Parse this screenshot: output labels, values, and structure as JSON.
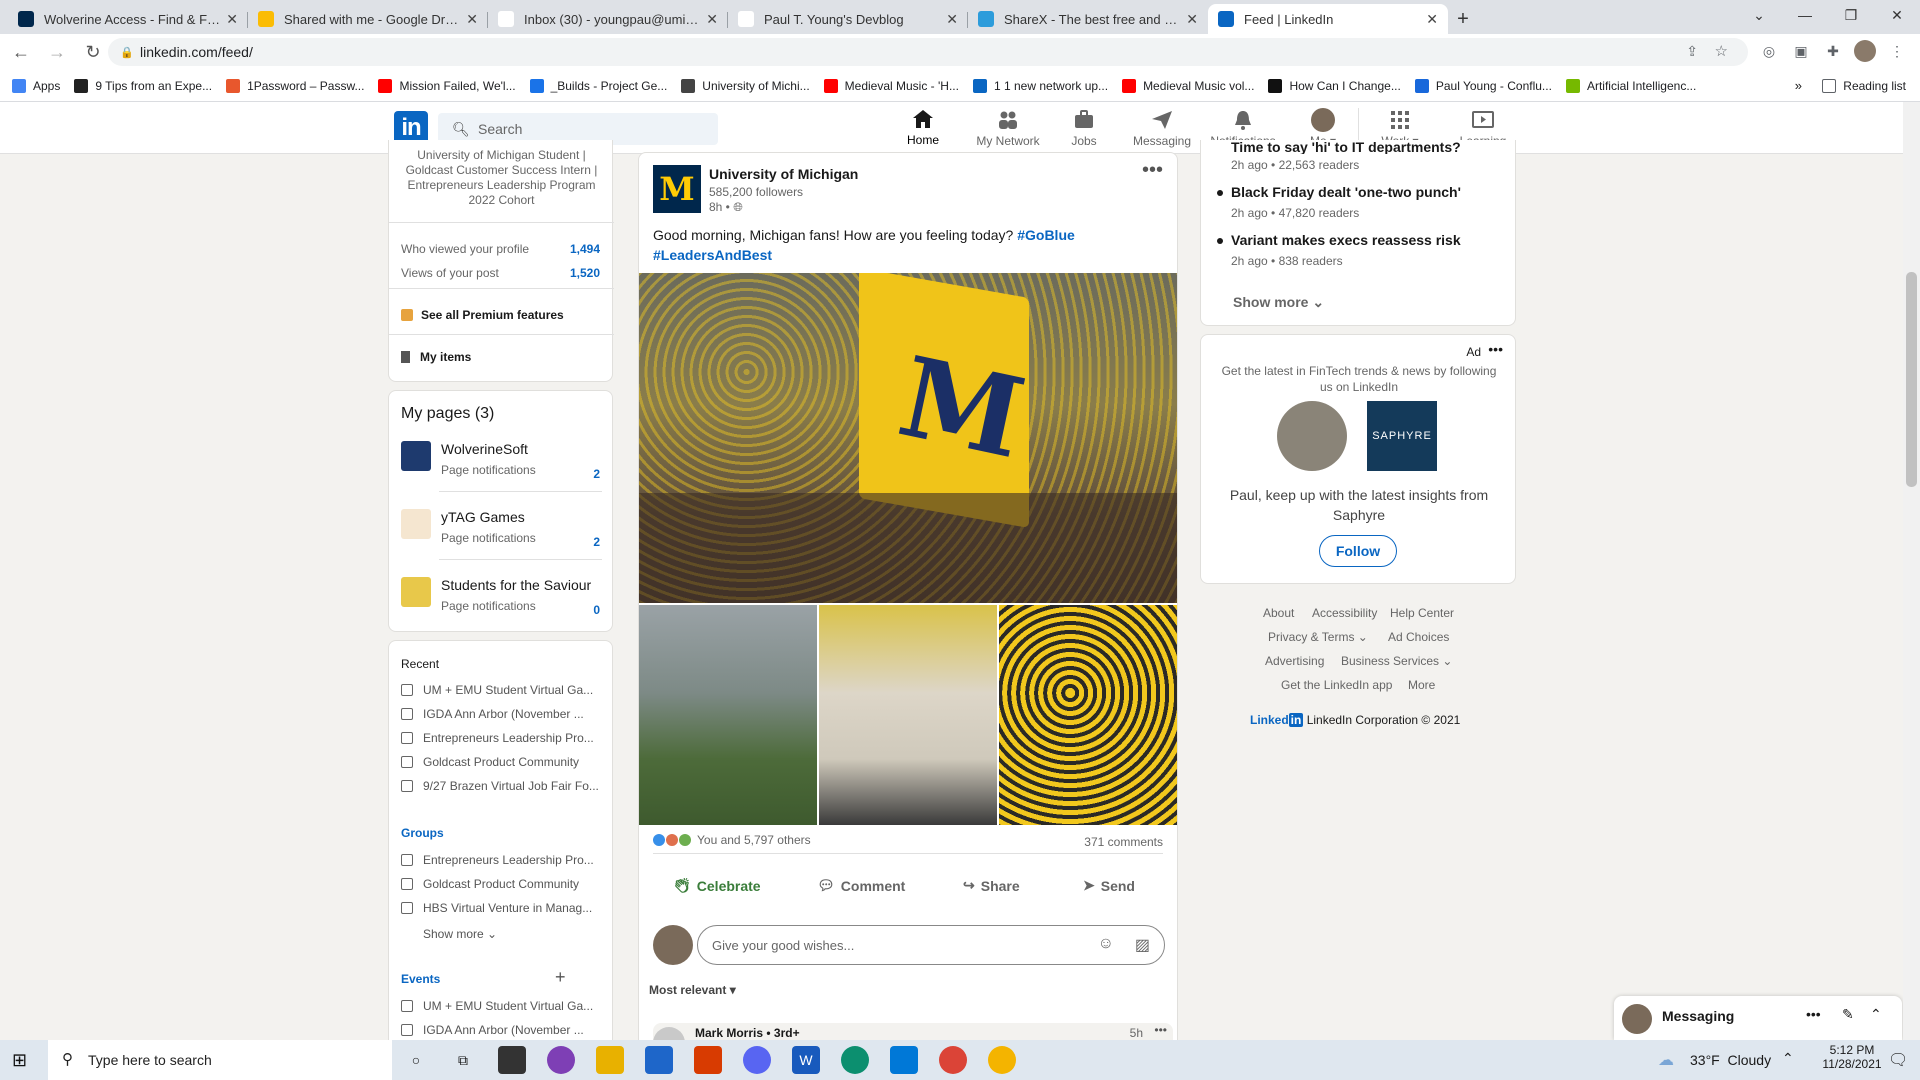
{
  "browser": {
    "tabs": [
      {
        "title": "Wolverine Access - Find & Favori",
        "icon": "M",
        "color": "#00274c",
        "iconcolor": "#ffcb05"
      },
      {
        "title": "Shared with me - Google Drive",
        "icon": "drive",
        "color": "#fbbc04",
        "iconcolor": "#fff"
      },
      {
        "title": "Inbox (30) - youngpau@umich.e",
        "icon": "M",
        "color": "#fff",
        "iconcolor": "#d93025"
      },
      {
        "title": "Paul T. Young's Devblog",
        "icon": "globe",
        "color": "#fff",
        "iconcolor": "#555"
      },
      {
        "title": "ShareX - The best free and open",
        "icon": "sharex",
        "color": "#2d9cdb",
        "iconcolor": "#fff"
      },
      {
        "title": "Feed | LinkedIn",
        "icon": "in",
        "color": "#0a66c2",
        "iconcolor": "#fff"
      }
    ],
    "url": "linkedin.com/feed/",
    "bookmarks": [
      "Apps",
      "9 Tips from an Expe...",
      "1Password – Passw...",
      "Mission Failed, We'l...",
      "_Builds - Project Ge...",
      "University of Michi...",
      "Medieval Music - 'H...",
      "1 1 new network up...",
      "Medieval Music vol...",
      "How Can I Change...",
      "Paul Young - Conflu...",
      "Artificial Intelligenc..."
    ],
    "reading_list": "Reading list"
  },
  "nav": {
    "search_placeholder": "Search",
    "items": [
      {
        "label": "Home"
      },
      {
        "label": "My Network"
      },
      {
        "label": "Jobs"
      },
      {
        "label": "Messaging"
      },
      {
        "label": "Notifications"
      },
      {
        "label": "Me"
      },
      {
        "label": "Work"
      },
      {
        "label": "Learning"
      }
    ]
  },
  "left": {
    "headline": [
      "University of Michigan Student |",
      "Goldcast Customer Success Intern |",
      "Entrepreneurs Leadership Program",
      "2022 Cohort"
    ],
    "stats": [
      {
        "label": "Who viewed your profile",
        "value": "1,494"
      },
      {
        "label": "Views of your post",
        "value": "1,520"
      }
    ],
    "premium": "See all Premium features",
    "my_items": "My items",
    "my_pages_title": "My pages (3)",
    "pages": [
      {
        "name": "WolverineSoft",
        "sub": "Page notifications",
        "count": "2"
      },
      {
        "name": "yTAG Games",
        "sub": "Page notifications",
        "count": "2"
      },
      {
        "name": "Students for the Saviour",
        "sub": "Page notifications",
        "count": "0"
      }
    ],
    "recent_title": "Recent",
    "recent": [
      "UM + EMU Student Virtual Ga...",
      "IGDA Ann Arbor (November ...",
      "Entrepreneurs Leadership Pro...",
      "Goldcast Product Community",
      "9/27 Brazen Virtual Job Fair Fo..."
    ],
    "groups_title": "Groups",
    "groups": [
      "Entrepreneurs Leadership Pro...",
      "Goldcast Product Community",
      "HBS Virtual Venture in Manag..."
    ],
    "show_more": "Show more",
    "events_title": "Events",
    "events": [
      "UM + EMU Student Virtual Ga...",
      "IGDA Ann Arbor (November ..."
    ]
  },
  "post": {
    "author": "University of Michigan",
    "followers": "585,200 followers",
    "time": "8h •",
    "text": "Good morning, Michigan fans! How are you feeling today?",
    "hashtag1": "#GoBlue",
    "hashtag2": "#LeadersAndBest",
    "reactions": "You and 5,797 others",
    "comments": "371 comments",
    "actions": [
      "Celebrate",
      "Comment",
      "Share",
      "Send"
    ],
    "comment_placeholder": "Give your good wishes...",
    "sort": "Most relevant",
    "next_author": "Mark Morris • 3rd+",
    "next_time": "5h"
  },
  "right": {
    "news_top": "Time to say 'hi' to IT departments?",
    "news": [
      {
        "title": "Time to say 'hi' to IT departments?",
        "sub": "2h ago • 22,563 readers"
      },
      {
        "title": "Black Friday dealt 'one-two punch'",
        "sub": "2h ago • 47,820 readers"
      },
      {
        "title": "Variant makes execs reassess risk",
        "sub": "2h ago • 838 readers"
      }
    ],
    "show_more": "Show more",
    "ad_label": "Ad",
    "ad_text": "Get the latest in FinTech trends & news by following us on LinkedIn",
    "ad_brand": "SAPHYRE",
    "ad_cta_text": "Paul, keep up with the latest insights from Saphyre",
    "follow": "Follow",
    "footer": [
      "About",
      "Accessibility",
      "Help Center",
      "Privacy & Terms",
      "Ad Choices",
      "Advertising",
      "Business Services",
      "Get the LinkedIn app",
      "More"
    ],
    "corp": "LinkedIn Corporation © 2021"
  },
  "messaging": {
    "title": "Messaging"
  },
  "taskbar": {
    "search": "Type here to search",
    "temp": "33°F",
    "weather": "Cloudy",
    "time": "5:12 PM",
    "date": "11/28/2021"
  }
}
